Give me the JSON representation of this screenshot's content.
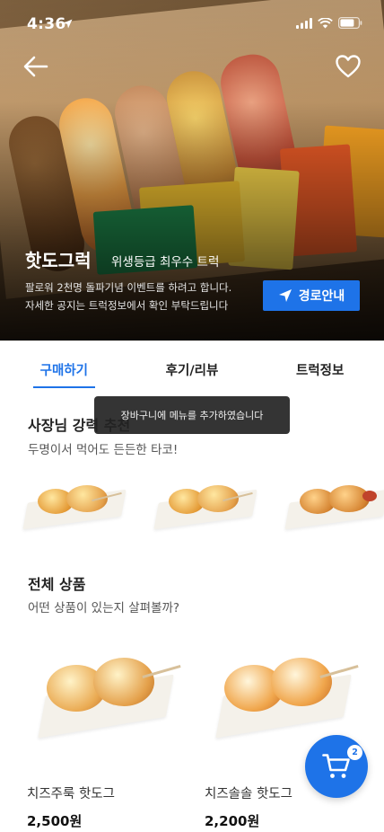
{
  "status_bar": {
    "time": "4:36"
  },
  "header": {
    "truck_name": "핫도그럭",
    "badge": "위생등급 최우수 트럭",
    "notice_line1": "팔로워 2천명 돌파기념 이벤트를 하려고 합니다.",
    "notice_line2": "자세한 공지는 트럭정보에서 확인 부탁드립니다",
    "route_button": "경로안내"
  },
  "tabs": [
    {
      "label": "구매하기",
      "active": true
    },
    {
      "label": "후기/리뷰",
      "active": false
    },
    {
      "label": "트럭정보",
      "active": false
    }
  ],
  "recommend": {
    "title": "사장님 강력 추천",
    "subtitle": "두명이서 먹어도 든든한 타코!"
  },
  "toast": "장바구니에 메뉴를 추가하였습니다",
  "all_products": {
    "title": "전체 상품",
    "subtitle": "어떤 상품이 있는지 살펴볼까?",
    "items": [
      {
        "name": "치즈주룩 핫도그",
        "price": "2,500원"
      },
      {
        "name": "치즈솔솔 핫도그",
        "price": "2,200원"
      }
    ]
  },
  "cart": {
    "count": "2"
  },
  "colors": {
    "accent": "#1e73e8"
  }
}
